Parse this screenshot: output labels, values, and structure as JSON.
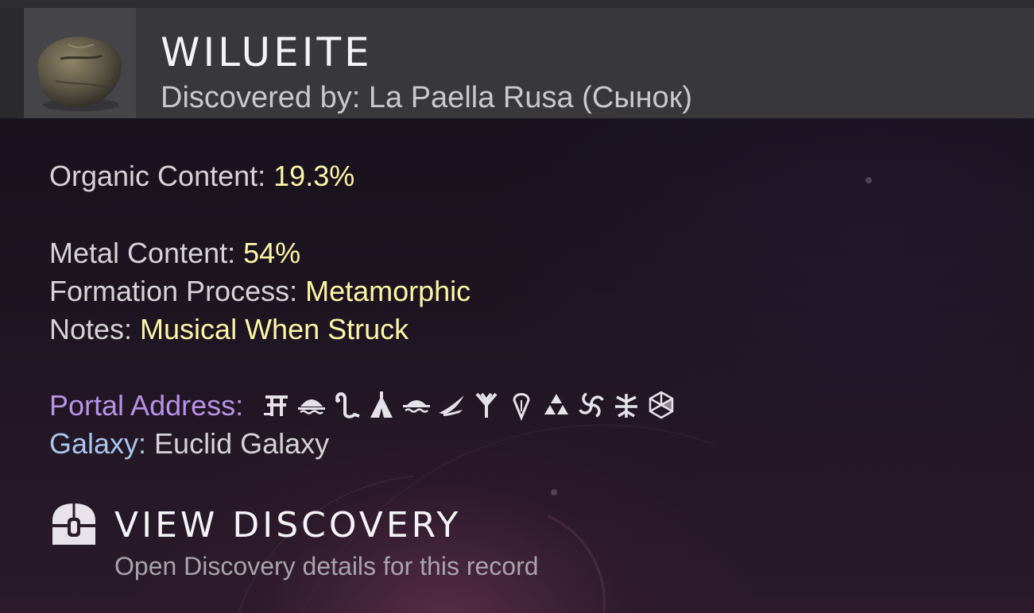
{
  "item": {
    "name": "WILUEITE",
    "discovered_by": "Discovered by: La Paella Rusa (Сынок)",
    "thumbnail_icon": "rock-icon"
  },
  "properties": {
    "organic": {
      "label": "Organic Content: ",
      "value": "19.3%"
    },
    "metal": {
      "label": "Metal Content: ",
      "value": "54%"
    },
    "formation": {
      "label": "Formation Process: ",
      "value": "Metamorphic"
    },
    "notes": {
      "label": "Notes: ",
      "value": "Musical When Struck"
    }
  },
  "portal": {
    "label": "Portal Address:",
    "glyph_icons": [
      "gate-glyph-icon",
      "dome-glyph-icon",
      "serpent-glyph-icon",
      "tent-glyph-icon",
      "saucer-glyph-icon",
      "bird-glyph-icon",
      "fork-glyph-icon",
      "drop-glyph-icon",
      "triangles-glyph-icon",
      "spiral-glyph-icon",
      "insect-glyph-icon",
      "hexagon-glyph-icon"
    ]
  },
  "galaxy": {
    "label": "Galaxy:",
    "value": " Euclid Galaxy"
  },
  "action": {
    "title": "VIEW DISCOVERY",
    "subtitle": "Open Discovery details for this record",
    "icon": "discovery-chest-icon"
  },
  "colors": {
    "value_highlight": "#fdf6a6",
    "portal_label": "#b992e8",
    "galaxy_label": "#a9c6ee",
    "header_bg": "#38383c"
  }
}
